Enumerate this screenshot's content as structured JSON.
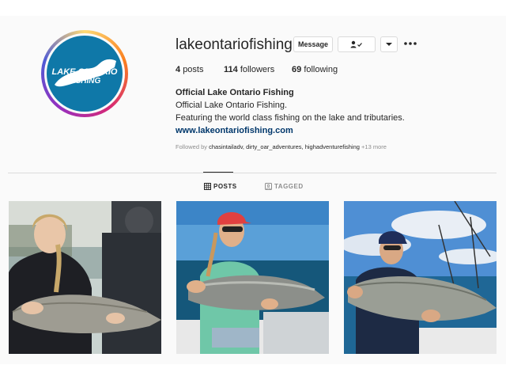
{
  "profile": {
    "username": "lakeontariofishing",
    "logo_text_line1": "LAKE ONTARIO",
    "logo_text_line2": "FISHING"
  },
  "actions": {
    "message_label": "Message",
    "follow_icon": "person-check-icon",
    "more_icon": "chevron-down-icon",
    "options_icon": "more-dots-icon"
  },
  "stats": {
    "posts_count": "4",
    "posts_label": "posts",
    "followers_count": "114",
    "followers_label": "followers",
    "following_count": "69",
    "following_label": "following"
  },
  "bio": {
    "name": "Official Lake Ontario Fishing",
    "line1": "Official Lake Ontario Fishing.",
    "line2": "Featuring the world class fishing on the lake and tributaries.",
    "link": "www.lakeontariofishing.com"
  },
  "followed_by": {
    "prefix": "Followed by",
    "names": "chasintailadv, dirty_oar_adventures, highadventurefishing",
    "more": "+13 more"
  },
  "tabs": [
    {
      "label": "POSTS",
      "icon": "grid-icon",
      "active": true
    },
    {
      "label": "TAGGED",
      "icon": "tag-icon",
      "active": false
    }
  ],
  "posts": [
    {
      "icon": "photo-woman-with-trout"
    },
    {
      "icon": "photo-woman-with-salmon"
    },
    {
      "icon": "photo-man-with-trout"
    }
  ],
  "colors": {
    "brand_blue": "#0f78a8",
    "link": "#00376b",
    "muted": "#8e8e8e",
    "border": "#dbdbdb"
  }
}
